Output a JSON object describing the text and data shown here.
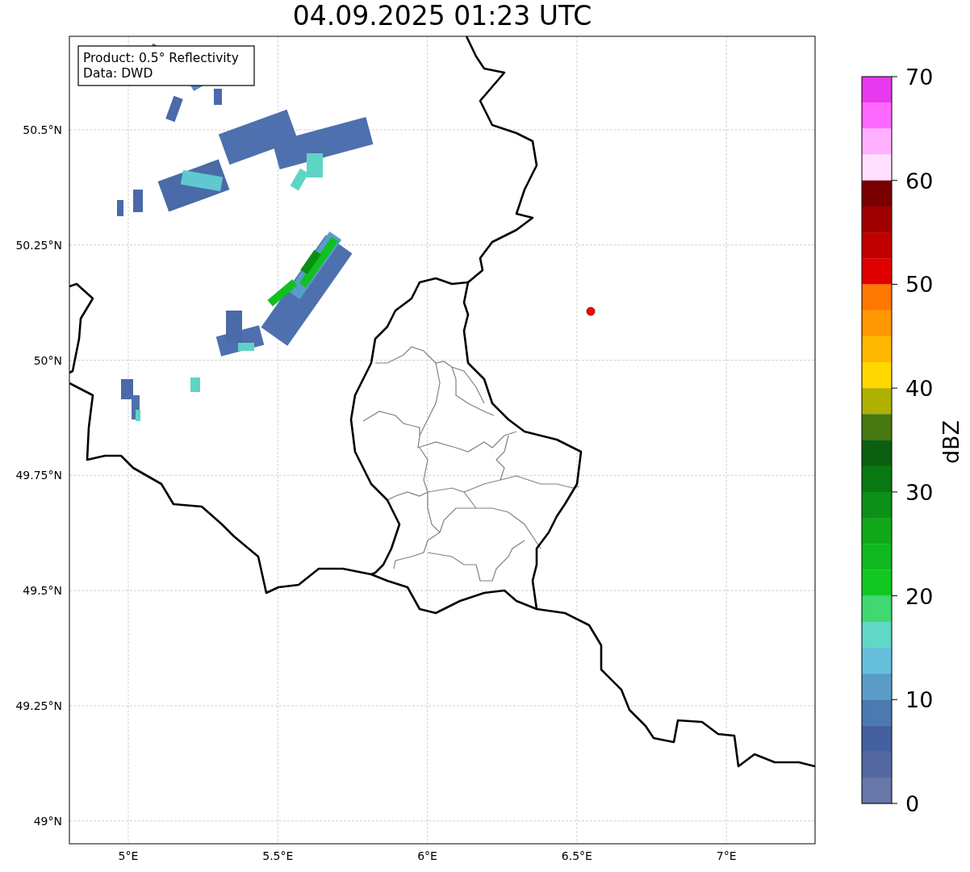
{
  "title": "04.09.2025 01:23 UTC",
  "info_box": [
    "Product: 0.5° Reflectivity",
    "Data: DWD"
  ],
  "map": {
    "lat_labels": [
      "50.5°N",
      "50.25°N",
      "50°N",
      "49.75°N",
      "49.5°N",
      "49.25°N",
      "49°N"
    ],
    "lon_labels": [
      "5°E",
      "5.5°E",
      "6°E",
      "6.5°E",
      "7°E"
    ]
  },
  "colorbar": {
    "label": "dBZ",
    "ticks": [
      "70",
      "60",
      "50",
      "40",
      "30",
      "20",
      "10",
      "0"
    ],
    "bins": [
      {
        "color": "#e838f0"
      },
      {
        "color": "#ff68ff"
      },
      {
        "color": "#ffb0ff"
      },
      {
        "color": "#ffe0ff"
      },
      {
        "color": "#780000"
      },
      {
        "color": "#a00000"
      },
      {
        "color": "#c00000"
      },
      {
        "color": "#e00000"
      },
      {
        "color": "#ff7800"
      },
      {
        "color": "#ff9800"
      },
      {
        "color": "#ffb800"
      },
      {
        "color": "#ffd800"
      },
      {
        "color": "#b0b000"
      },
      {
        "color": "#487810"
      },
      {
        "color": "#0a6010"
      },
      {
        "color": "#0a7812"
      },
      {
        "color": "#0c9018"
      },
      {
        "color": "#10a818"
      },
      {
        "color": "#10b820"
      },
      {
        "color": "#10c820"
      },
      {
        "color": "#40d870"
      },
      {
        "color": "#60d8c8"
      },
      {
        "color": "#66c0dc"
      },
      {
        "color": "#5a9cc8"
      },
      {
        "color": "#4a7ab0"
      },
      {
        "color": "#4560a0"
      },
      {
        "color": "#5468a0"
      },
      {
        "color": "#6677a8"
      }
    ]
  }
}
